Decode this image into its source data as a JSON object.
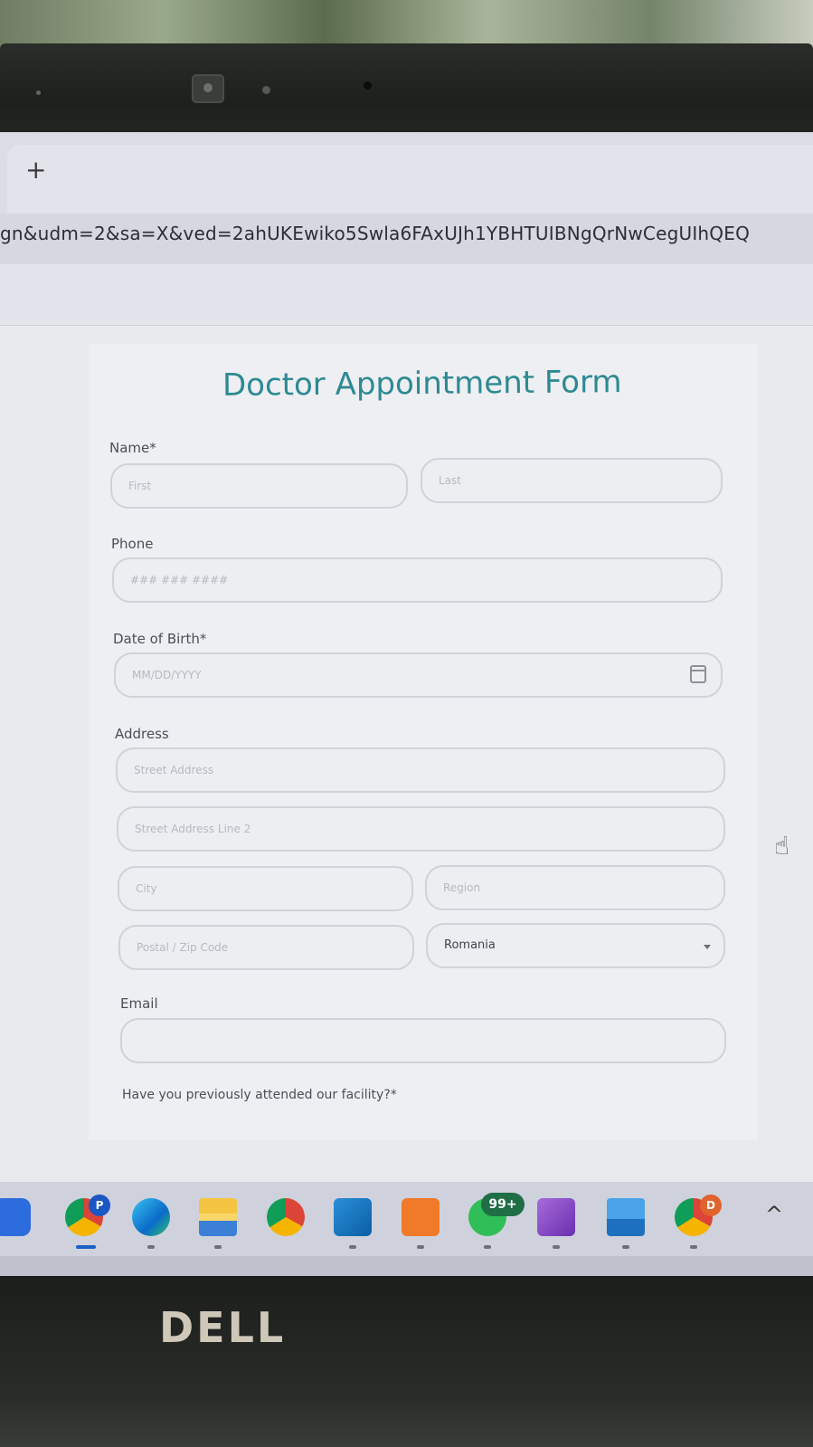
{
  "browser": {
    "new_tab_symbol": "+",
    "url_fragment": "gn&udm=2&sa=X&ved=2ahUKEwiko5Swla6FAxUJh1YBHTUIBNgQrNwCegUIhQEQ"
  },
  "form": {
    "title": "Doctor Appointment Form",
    "name": {
      "label": "Name*",
      "first_placeholder": "First",
      "last_placeholder": "Last"
    },
    "phone": {
      "label": "Phone",
      "placeholder": "### ### ####"
    },
    "dob": {
      "label": "Date of Birth*",
      "placeholder": "MM/DD/YYYY",
      "icon": "calendar-icon"
    },
    "address": {
      "label": "Address",
      "street_placeholder": "Street Address",
      "street2_placeholder": "Street Address Line 2",
      "city_placeholder": "City",
      "region_placeholder": "Region",
      "postal_placeholder": "Postal / Zip Code",
      "country_value": "Romania"
    },
    "email": {
      "label": "Email",
      "placeholder": ""
    },
    "attended_question": "Have you previously attended our facility?*"
  },
  "taskbar": {
    "apps": [
      "zoom-icon",
      "chrome-profile-p-icon",
      "edge-icon",
      "file-explorer-icon",
      "chrome-icon",
      "vscode-icon",
      "xampp-icon",
      "whatsapp-icon",
      "visual-studio-icon",
      "photos-icon",
      "chrome-profile-d-icon"
    ],
    "chrome_profile_badge": "P",
    "whatsapp_badge": "99+",
    "chrome_d_badge": "D",
    "tray_chevron": "^"
  },
  "laptop": {
    "brand": "DELL"
  },
  "colors": {
    "accent": "#2d8a92",
    "taskbar_active": "#1b5fc9"
  }
}
